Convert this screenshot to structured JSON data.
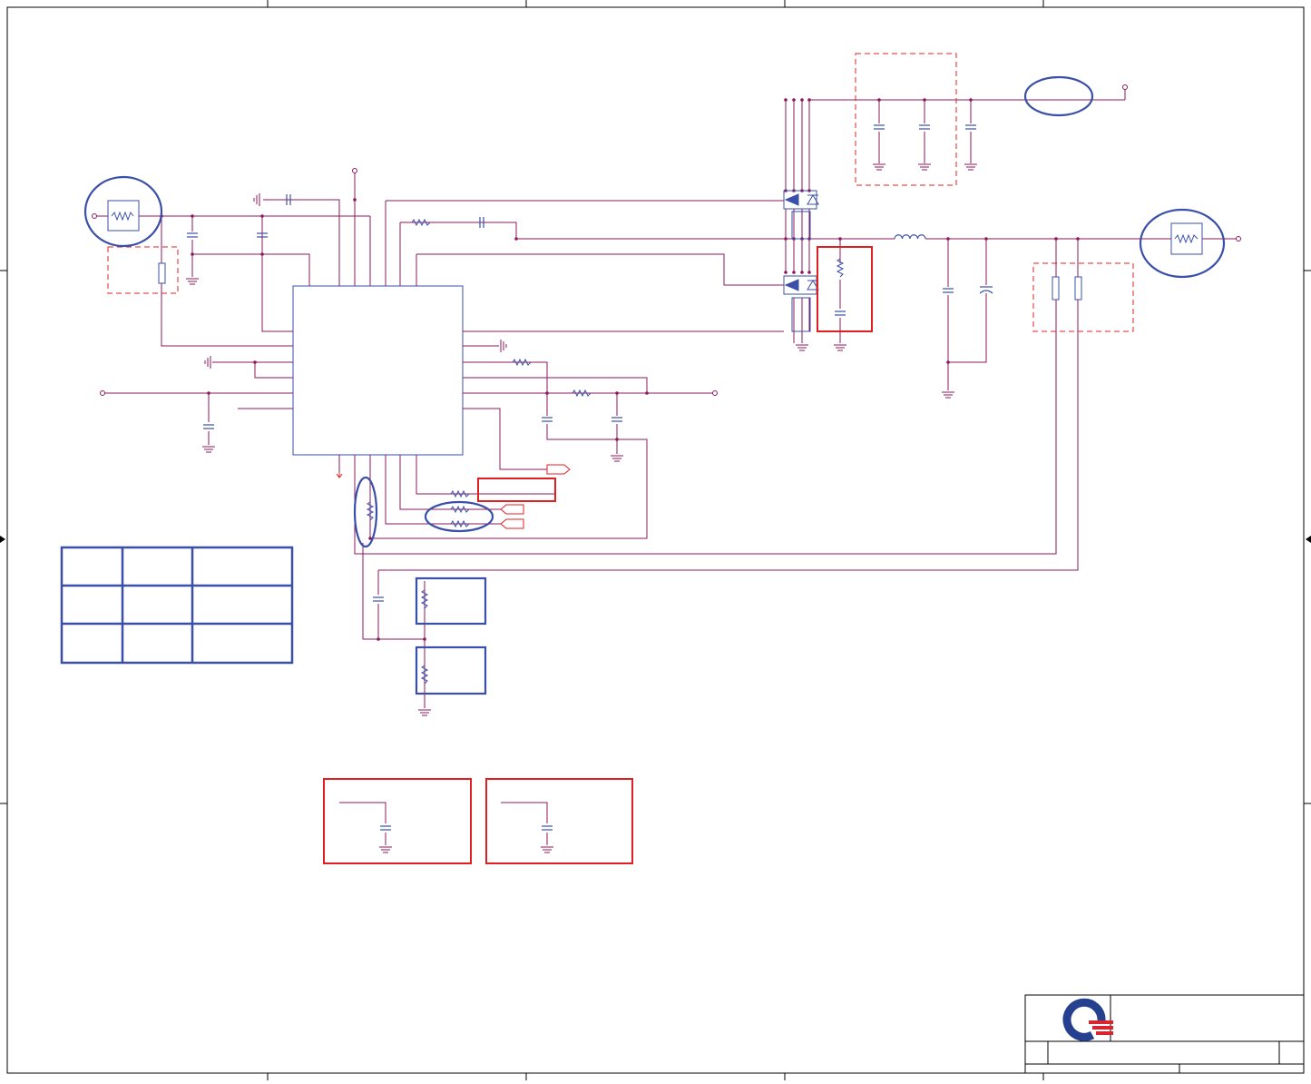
{
  "colors": {
    "wire": "#8b1a5c",
    "component": "#3a4fa8",
    "highlight_red": "#e02020",
    "highlight_blue": "#3a4fa8",
    "border": "#000000",
    "logo_red": "#d9262e",
    "logo_blue": "#24408e"
  },
  "icons": {
    "logo": "company-logo-icon",
    "mosfet": "n-mosfet-icon",
    "resistor": "resistor-icon",
    "capacitor": "capacitor-icon",
    "inductor": "inductor-icon",
    "ground": "ground-icon",
    "port": "offpage-connector-icon"
  },
  "table": {
    "rows": 3,
    "columns": 3
  }
}
